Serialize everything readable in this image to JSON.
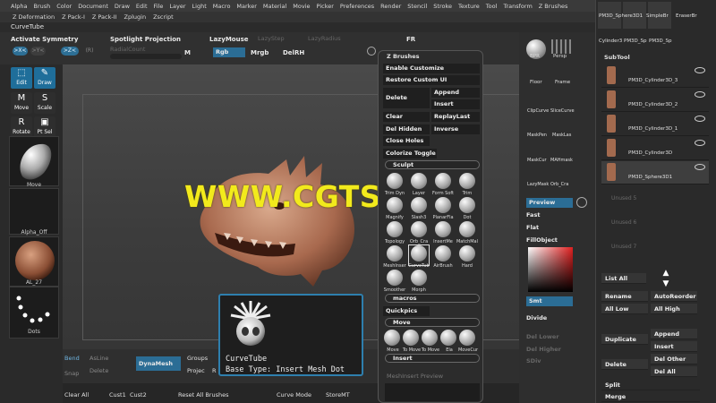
{
  "menu": [
    "Alpha",
    "Brush",
    "Color",
    "Document",
    "Draw",
    "Edit",
    "File",
    "Layer",
    "Light",
    "Macro",
    "Marker",
    "Material",
    "Movie",
    "Picker",
    "Preferences",
    "Render",
    "Stencil",
    "Stroke",
    "Texture",
    "Tool",
    "Transform",
    "Z Brushes"
  ],
  "menu2": [
    "Z Deformation",
    "Z Pack-I",
    "Z Pack-II",
    "Zplugin",
    "Zscript"
  ],
  "title": "CurveTube",
  "shelf": {
    "activate_symmetry": "Activate Symmetry",
    "spotlight_projection": "Spotlight Projection",
    "lazymouse": "LazyMouse",
    "lazystep": "LazyStep",
    "lazyradius": "LazyRadius",
    "fr": "FR",
    "radial_count": "RadialCount",
    "m": "M",
    "rgb": "Rgb",
    "mrgb": "Mrgb",
    "delrh": "DelRH",
    "axis": [
      ">X<",
      ">Y<",
      ">Z<",
      "(R)"
    ]
  },
  "left": {
    "edit": "Edit",
    "draw": "Draw",
    "move": "Move",
    "scale": "Scale",
    "rotate": "Rotate",
    "ptsel": "Pt Sel",
    "brush_name": "Move",
    "alpha_label": "Alpha_Off",
    "material_label": "AL_27",
    "stroke_label": "Dots"
  },
  "bottom": {
    "bend": "Bend",
    "asline": "AsLine",
    "snap": "Snap",
    "delete": "Delete",
    "dynamesh": "DynaMesh",
    "groups": "Groups",
    "projec": "Projec",
    "r": "R",
    "clear_all": "Clear All",
    "cust1": "Cust1",
    "cust2": "Cust2",
    "reset_all": "Reset All Brushes",
    "curve_mode": "Curve Mode",
    "storemt": "StoreMT"
  },
  "zpanel": {
    "title": "Z Brushes",
    "enable_customize": "Enable Customize",
    "restore_custom_ui": "Restore Custom UI",
    "delete": "Delete",
    "append": "Append",
    "insert": "Insert",
    "clear": "Clear",
    "replaylast": "ReplayLast",
    "del_hidden": "Del Hidden",
    "inverse": "Inverse",
    "close_holes": "Close Holes",
    "colorize_toggle": "Colorize Toggle",
    "sculpt": "Sculpt",
    "brushes": [
      "Trim Dyn",
      "Layer",
      "Form Soft",
      "Trim",
      "Magnify",
      "Slash3",
      "PlanarFla",
      "Dot",
      "Topology",
      "Orb_Cra",
      "InsertMe",
      "MatchMal",
      "MeshInser",
      "CurveTub",
      "AirBrush",
      "Hard",
      "Smoother",
      "Morph"
    ],
    "macros": "macros",
    "quickpics": "Quickpics",
    "move": "Move",
    "move_brushes": [
      "Move",
      "To Move",
      "To Move",
      "Ela",
      "MoveCur"
    ],
    "insert_sec": "Insert",
    "meshinsert_preview": "MeshInsert Preview"
  },
  "tooltip": {
    "name": "CurveTube",
    "type": "Base Type: Insert Mesh Dot"
  },
  "rightcol": {
    "bpr": "BPR",
    "persp": "Persp",
    "floor": "Floor",
    "frame": "Frame",
    "clipcurve": "ClipCurve",
    "slicecurve": "SliceCurve",
    "maskpen": "MaskPen",
    "masklasso": "MaskLas",
    "maskcurve": "MaskCur",
    "mahmask": "MAHmask",
    "lazymask": "LazyMask",
    "orbcra": "Orb_Cra",
    "preview": "Preview",
    "fast": "Fast",
    "flat": "Flat",
    "fillobject": "FillObject",
    "smt": "Smt",
    "divide": "Divide",
    "del_lower": "Del Lower",
    "del_higher": "Del Higher",
    "sdiv": "SDiv"
  },
  "rightpanel": {
    "top_items": [
      "PM3D_Sphere3D1",
      "SimpleBr",
      "EraserBr",
      "Cylinder3",
      "PM3D_Sp",
      "PM3D_Sp"
    ],
    "subtool": "SubTool",
    "subtools": [
      "PM3D_Cylinder3D_3",
      "PM3D_Cylinder3D_2",
      "PM3D_Cylinder3D_1",
      "PM3D_Cylinder3D",
      "PM3D_Sphere3D1"
    ],
    "unused": [
      "Unused 5",
      "Unused 6",
      "Unused 7"
    ],
    "list_all": "List All",
    "rename": "Rename",
    "autoreorder": "AutoReorder",
    "all_low": "All Low",
    "all_high": "All High",
    "append": "Append",
    "duplicate": "Duplicate",
    "insert": "Insert",
    "delete": "Delete",
    "del_other": "Del Other",
    "del_all": "Del All",
    "split": "Split",
    "merge": "Merge"
  },
  "watermark": "WWW.CGTSJ.COM",
  "colors": {
    "accent_blue": "#2b6d95",
    "watermark_yellow": "#f2ea1c",
    "panel_dark": "#2c2c2c"
  }
}
